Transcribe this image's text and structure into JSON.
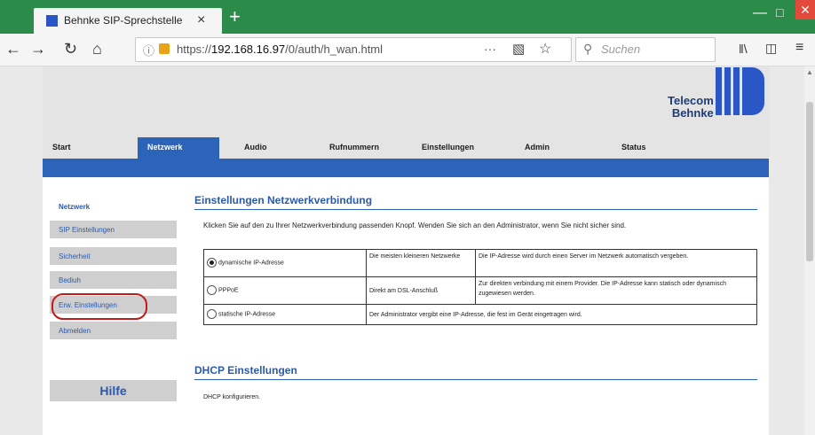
{
  "browser": {
    "tab_title": "Behnke SIP-Sprechstelle",
    "tab_close": "×",
    "new_tab": "+",
    "url_prefix": "https://",
    "url_host": "192.168.16.97",
    "url_path": "/0/auth/h_wan.html",
    "search_placeholder": "Suchen",
    "page_actions": "···"
  },
  "header": {
    "logo_line1": "Telecom",
    "logo_line2": "Behnke"
  },
  "menu": {
    "items": [
      "Start",
      "Netzwerk",
      "Audio",
      "Rufnummern",
      "Einstellungen",
      "Admin",
      "Status"
    ],
    "active": "Netzwerk"
  },
  "sidebar": {
    "items": [
      {
        "label": "Netzwerk"
      },
      {
        "label": "SIP Einstellungen"
      },
      {
        "label": "Sicherheit"
      },
      {
        "label": "Bediuh"
      },
      {
        "label": "Erw. Einstellungen"
      },
      {
        "label": "Abmelden"
      }
    ],
    "help_label": "Hilfe",
    "highlighted": "Erw. Einstellungen"
  },
  "main": {
    "title": "Einstellungen Netzwerkverbindung",
    "intro": "Klicken Sie auf den zu Ihrer Netzwerkverbindung passenden Knopf. Wenden Sie sich an den Administrator, wenn Sie nicht sicher sind.",
    "options": [
      {
        "label": "dynamische IP-Adresse",
        "selected": true,
        "usage": "Die meisten kleineren Netzwerke",
        "description": "Die IP-Adresse wird durch einen Server im Netzwerk automatisch vergeben."
      },
      {
        "label": "PPPoE",
        "selected": false,
        "usage": "Direkt am DSL-Anschluß",
        "description": "Zur direkten verbindung mit einem Provider. Die IP-Adresse kann statisch oder dynamisch zugewiesen werden."
      },
      {
        "label": "statische IP-Adresse",
        "selected": false,
        "usage": "Der Administrator vergibt eine IP-Adresse, die fest im Gerät eingetragen wird.",
        "description": ""
      }
    ],
    "dhcp_title": "DHCP Einstellungen",
    "dhcp_text": "DHCP konfigurieren."
  },
  "colors": {
    "browser_accent": "#2b8c4a",
    "brand_blue": "#2b64b8",
    "link_blue": "#2b5aab",
    "highlight_red": "#c21a1a"
  }
}
